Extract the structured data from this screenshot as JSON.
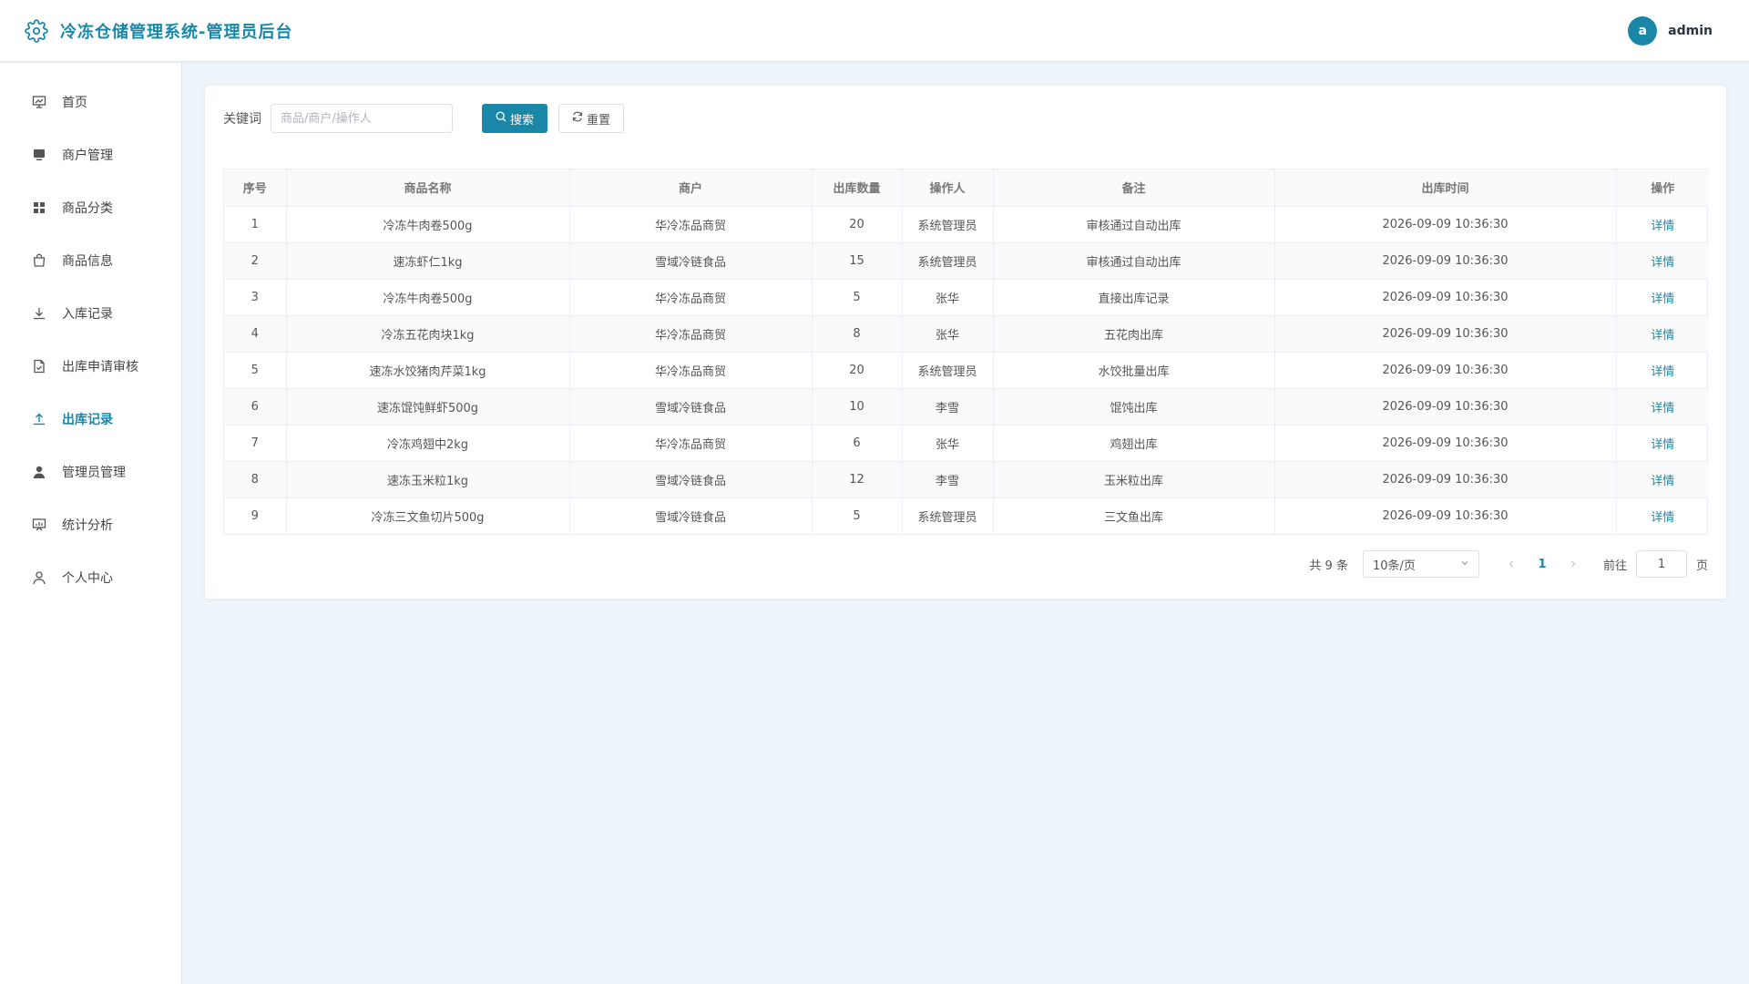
{
  "header": {
    "title": "冷冻仓储管理系统-管理员后台",
    "avatar_letter": "a",
    "username": "admin"
  },
  "theme": {
    "accent": "#1a87a8"
  },
  "sidebar": {
    "items": [
      {
        "label": "首页",
        "icon": "presentation-icon",
        "active": false
      },
      {
        "label": "商户管理",
        "icon": "monitor-icon",
        "active": false
      },
      {
        "label": "商品分类",
        "icon": "grid-icon",
        "active": false
      },
      {
        "label": "商品信息",
        "icon": "shopping-bag-icon",
        "active": false
      },
      {
        "label": "入库记录",
        "icon": "download-icon",
        "active": false
      },
      {
        "label": "出库申请审核",
        "icon": "document-check-icon",
        "active": false
      },
      {
        "label": "出库记录",
        "icon": "upload-icon",
        "active": true
      },
      {
        "label": "管理员管理",
        "icon": "user-filled-icon",
        "active": false
      },
      {
        "label": "统计分析",
        "icon": "chart-board-icon",
        "active": false
      },
      {
        "label": "个人中心",
        "icon": "user-outline-icon",
        "active": false
      }
    ]
  },
  "toolbar": {
    "keyword_label": "关键词",
    "search_placeholder": "商品/商户/操作人",
    "search_value": "",
    "search_label": "搜索",
    "reset_label": "重置"
  },
  "table": {
    "columns": [
      "序号",
      "商品名称",
      "商户",
      "出库数量",
      "操作人",
      "备注",
      "出库时间",
      "操作"
    ],
    "rows": [
      [
        "1",
        "冷冻牛肉卷500g",
        "华冷冻品商贸",
        "20",
        "系统管理员",
        "审核通过自动出库",
        "2026-09-09 10:36:30",
        "详情"
      ],
      [
        "2",
        "速冻虾仁1kg",
        "雪域冷链食品",
        "15",
        "系统管理员",
        "审核通过自动出库",
        "2026-09-09 10:36:30",
        "详情"
      ],
      [
        "3",
        "冷冻牛肉卷500g",
        "华冷冻品商贸",
        "5",
        "张华",
        "直接出库记录",
        "2026-09-09 10:36:30",
        "详情"
      ],
      [
        "4",
        "冷冻五花肉块1kg",
        "华冷冻品商贸",
        "8",
        "张华",
        "五花肉出库",
        "2026-09-09 10:36:30",
        "详情"
      ],
      [
        "5",
        "速冻水饺猪肉芹菜1kg",
        "华冷冻品商贸",
        "20",
        "系统管理员",
        "水饺批量出库",
        "2026-09-09 10:36:30",
        "详情"
      ],
      [
        "6",
        "速冻馄饨鲜虾500g",
        "雪域冷链食品",
        "10",
        "李雪",
        "馄饨出库",
        "2026-09-09 10:36:30",
        "详情"
      ],
      [
        "7",
        "冷冻鸡翅中2kg",
        "华冷冻品商贸",
        "6",
        "张华",
        "鸡翅出库",
        "2026-09-09 10:36:30",
        "详情"
      ],
      [
        "8",
        "速冻玉米粒1kg",
        "雪域冷链食品",
        "12",
        "李雪",
        "玉米粒出库",
        "2026-09-09 10:36:30",
        "详情"
      ],
      [
        "9",
        "冷冻三文鱼切片500g",
        "雪域冷链食品",
        "5",
        "系统管理员",
        "三文鱼出库",
        "2026-09-09 10:36:30",
        "详情"
      ]
    ]
  },
  "pagination": {
    "total_text": "共 9 条",
    "page_size": "10条/页",
    "current_page": "1",
    "goto_label": "前往",
    "goto_value": "1",
    "page_unit": "页"
  }
}
